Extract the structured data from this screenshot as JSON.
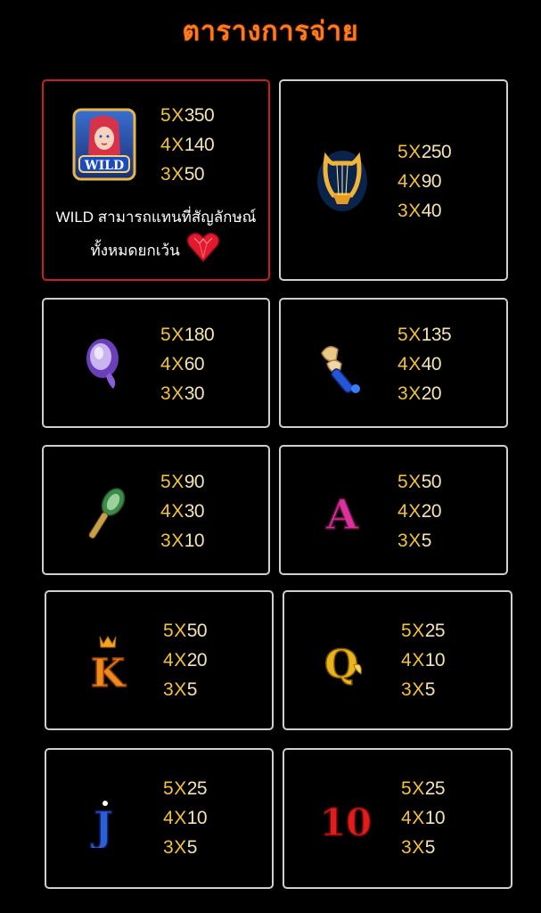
{
  "header": {
    "title": "ตารางการจ่าย"
  },
  "colors": {
    "title": "#ff7a1c",
    "pay": "#f2c23b",
    "wild_border": "#c81f24",
    "card_border": "#cfcfcf"
  },
  "symbols": [
    {
      "id": "wild",
      "icon": "mermaid-wild-icon",
      "icon_label": "WILD",
      "pays": [
        {
          "count": "5",
          "x": "X",
          "value": "350"
        },
        {
          "count": "4",
          "x": "X",
          "value": "140"
        },
        {
          "count": "3",
          "x": "X",
          "value": "50"
        }
      ],
      "desc_line1": "WILD สามารถแทนที่สัญลักษณ์",
      "desc_line2": "ทั้งหมดยกเว้น"
    },
    {
      "id": "lyre",
      "icon": "golden-lyre-icon",
      "pays": [
        {
          "count": "5",
          "x": "X",
          "value": "250"
        },
        {
          "count": "4",
          "x": "X",
          "value": "90"
        },
        {
          "count": "3",
          "x": "X",
          "value": "40"
        }
      ]
    },
    {
      "id": "shell",
      "icon": "purple-shell-icon",
      "pays": [
        {
          "count": "5",
          "x": "X",
          "value": "180"
        },
        {
          "count": "4",
          "x": "X",
          "value": "60"
        },
        {
          "count": "3",
          "x": "X",
          "value": "30"
        }
      ]
    },
    {
      "id": "conch",
      "icon": "conch-horn-icon",
      "pays": [
        {
          "count": "5",
          "x": "X",
          "value": "135"
        },
        {
          "count": "4",
          "x": "X",
          "value": "40"
        },
        {
          "count": "3",
          "x": "X",
          "value": "20"
        }
      ]
    },
    {
      "id": "mirror",
      "icon": "seaweed-mirror-icon",
      "pays": [
        {
          "count": "5",
          "x": "X",
          "value": "90"
        },
        {
          "count": "4",
          "x": "X",
          "value": "30"
        },
        {
          "count": "3",
          "x": "X",
          "value": "10"
        }
      ]
    },
    {
      "id": "a",
      "icon": "letter-a-icon",
      "icon_label": "A",
      "pays": [
        {
          "count": "5",
          "x": "X",
          "value": "50"
        },
        {
          "count": "4",
          "x": "X",
          "value": "20"
        },
        {
          "count": "3",
          "x": "X",
          "value": "5"
        }
      ]
    },
    {
      "id": "k",
      "icon": "letter-k-icon",
      "icon_label": "K",
      "pays": [
        {
          "count": "5",
          "x": "X",
          "value": "50"
        },
        {
          "count": "4",
          "x": "X",
          "value": "20"
        },
        {
          "count": "3",
          "x": "X",
          "value": "5"
        }
      ]
    },
    {
      "id": "q",
      "icon": "letter-q-icon",
      "icon_label": "Q",
      "pays": [
        {
          "count": "5",
          "x": "X",
          "value": "25"
        },
        {
          "count": "4",
          "x": "X",
          "value": "10"
        },
        {
          "count": "3",
          "x": "X",
          "value": "5"
        }
      ]
    },
    {
      "id": "j",
      "icon": "letter-j-icon",
      "icon_label": "J",
      "pays": [
        {
          "count": "5",
          "x": "X",
          "value": "25"
        },
        {
          "count": "4",
          "x": "X",
          "value": "10"
        },
        {
          "count": "3",
          "x": "X",
          "value": "5"
        }
      ]
    },
    {
      "id": "ten",
      "icon": "number-10-icon",
      "icon_label": "10",
      "pays": [
        {
          "count": "5",
          "x": "X",
          "value": "25"
        },
        {
          "count": "4",
          "x": "X",
          "value": "10"
        },
        {
          "count": "3",
          "x": "X",
          "value": "5"
        }
      ]
    }
  ]
}
